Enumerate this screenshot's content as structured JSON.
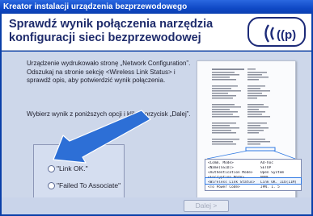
{
  "window": {
    "title": "Kreator instalacji urządzenia bezprzewodowego"
  },
  "header": {
    "title_line1": "Sprawdź wynik połączenia narzędzia",
    "title_line2": "konfiguracji sieci bezprzewodowej"
  },
  "instructions": {
    "paragraph1": "Urządzenie wydrukowało stronę „Network Configuration”. Odszukaj na stronie sekcję <Wireless Link Status> i sprawdź opis, aby potwierdzić wynik połączenia.",
    "paragraph2": "Wybierz wynik z poniższych opcji i kliknij przycisk „Dalej”."
  },
  "options": [
    {
      "label": "\"Link OK.\""
    },
    {
      "label": "\"Failed To Associate\""
    }
  ],
  "report_zoom": {
    "rows": [
      {
        "key": "<Comm. Mode>",
        "value": "Ad-hoc"
      },
      {
        "key": "<Name(SSID)>",
        "value": "SETUP"
      },
      {
        "key": "<Authentication Mode>",
        "value": "Open System"
      },
      {
        "key": "<Encryption Mode>",
        "value": "NONE"
      },
      {
        "key": "<Wireless Link Status>",
        "value": "Link OK. 11b(11M)"
      },
      {
        "key": "<To Power Code>",
        "value": "JPN. 1. 5"
      }
    ]
  },
  "footer": {
    "next_label": "Dalej >"
  },
  "colors": {
    "title_bar": "#0f49c6",
    "header_text": "#1e2b6b",
    "content_bg": "#cdd7ea",
    "arrow_blue": "#2d6fd6",
    "highlight": "#2f79e3"
  },
  "icons": {
    "logo": "wireless-brand-logo-icon",
    "arrow": "pointer-arrow-icon"
  }
}
